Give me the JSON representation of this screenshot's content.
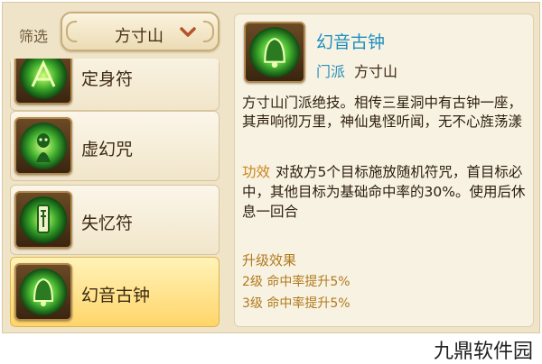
{
  "filter": {
    "label": "筛选",
    "selected": "方寸山"
  },
  "skills": [
    {
      "name": "定身符",
      "icon": "seal-talisman-icon"
    },
    {
      "name": "虚幻咒",
      "icon": "illusion-spell-icon"
    },
    {
      "name": "失忆符",
      "icon": "amnesia-talisman-icon"
    },
    {
      "name": "幻音古钟",
      "icon": "ancient-bell-icon",
      "selected": true
    }
  ],
  "detail": {
    "title": "幻音古钟",
    "school_key": "门派",
    "school_value": "方寸山",
    "description": "方寸山门派绝技。相传三星洞中有古钟一座，其声响彻万里，神仙鬼怪听闻，无不心旌荡漾",
    "effect_key": "功效",
    "effect_text": "对敌方5个目标施放随机符咒，首目标必中，其他目标为基础命中率的30%。使用后休息一回合",
    "upgrade_title": "升级效果",
    "upgrades": [
      "2级  命中率提升5%",
      "3级  命中率提升5%"
    ]
  },
  "watermark": "九鼎软件园",
  "colors": {
    "accent_title": "#1d8fc0",
    "effect_key": "#c9851b",
    "upgrade_text": "#b07a1e",
    "selected_row": "#ffd56a",
    "panel_bg": "#efe4c8"
  }
}
